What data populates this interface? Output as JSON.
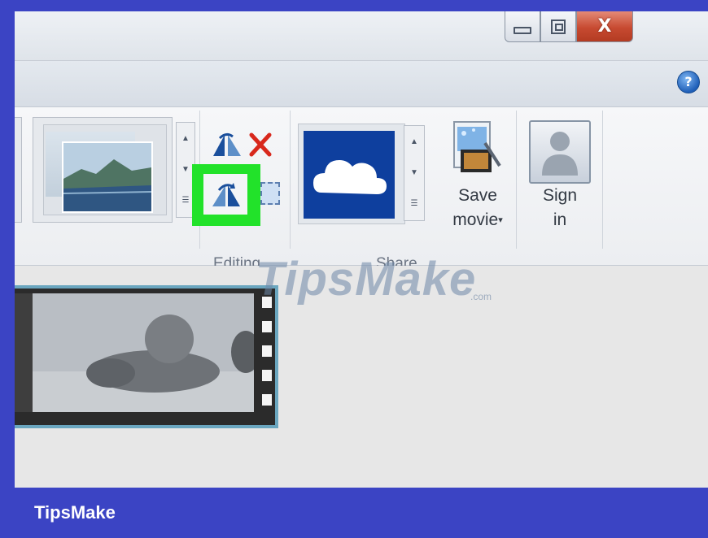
{
  "window": {
    "controls": {
      "minimize_icon": "minimize-icon",
      "maximize_icon": "restore-icon",
      "close_label": "X"
    },
    "help_label": "?"
  },
  "ribbon": {
    "editing": {
      "label": "Editing",
      "tools": [
        "rotate-left-icon",
        "remove-icon",
        "rotate-right-icon",
        "select-all-icon"
      ],
      "highlight_color": "#22e22a"
    },
    "share": {
      "label": "Share",
      "tile": "onedrive-cloud-icon",
      "tile_color": "#0e3f9e"
    },
    "save_movie": {
      "line1": "Save",
      "line2": "movie"
    },
    "sign_in": {
      "line1": "Sign",
      "line2": "in"
    }
  },
  "watermark": {
    "text": "TipsMake",
    "suffix": ".com"
  },
  "footer": {
    "brand": "TipsMake",
    "color": "#3b44c4"
  }
}
